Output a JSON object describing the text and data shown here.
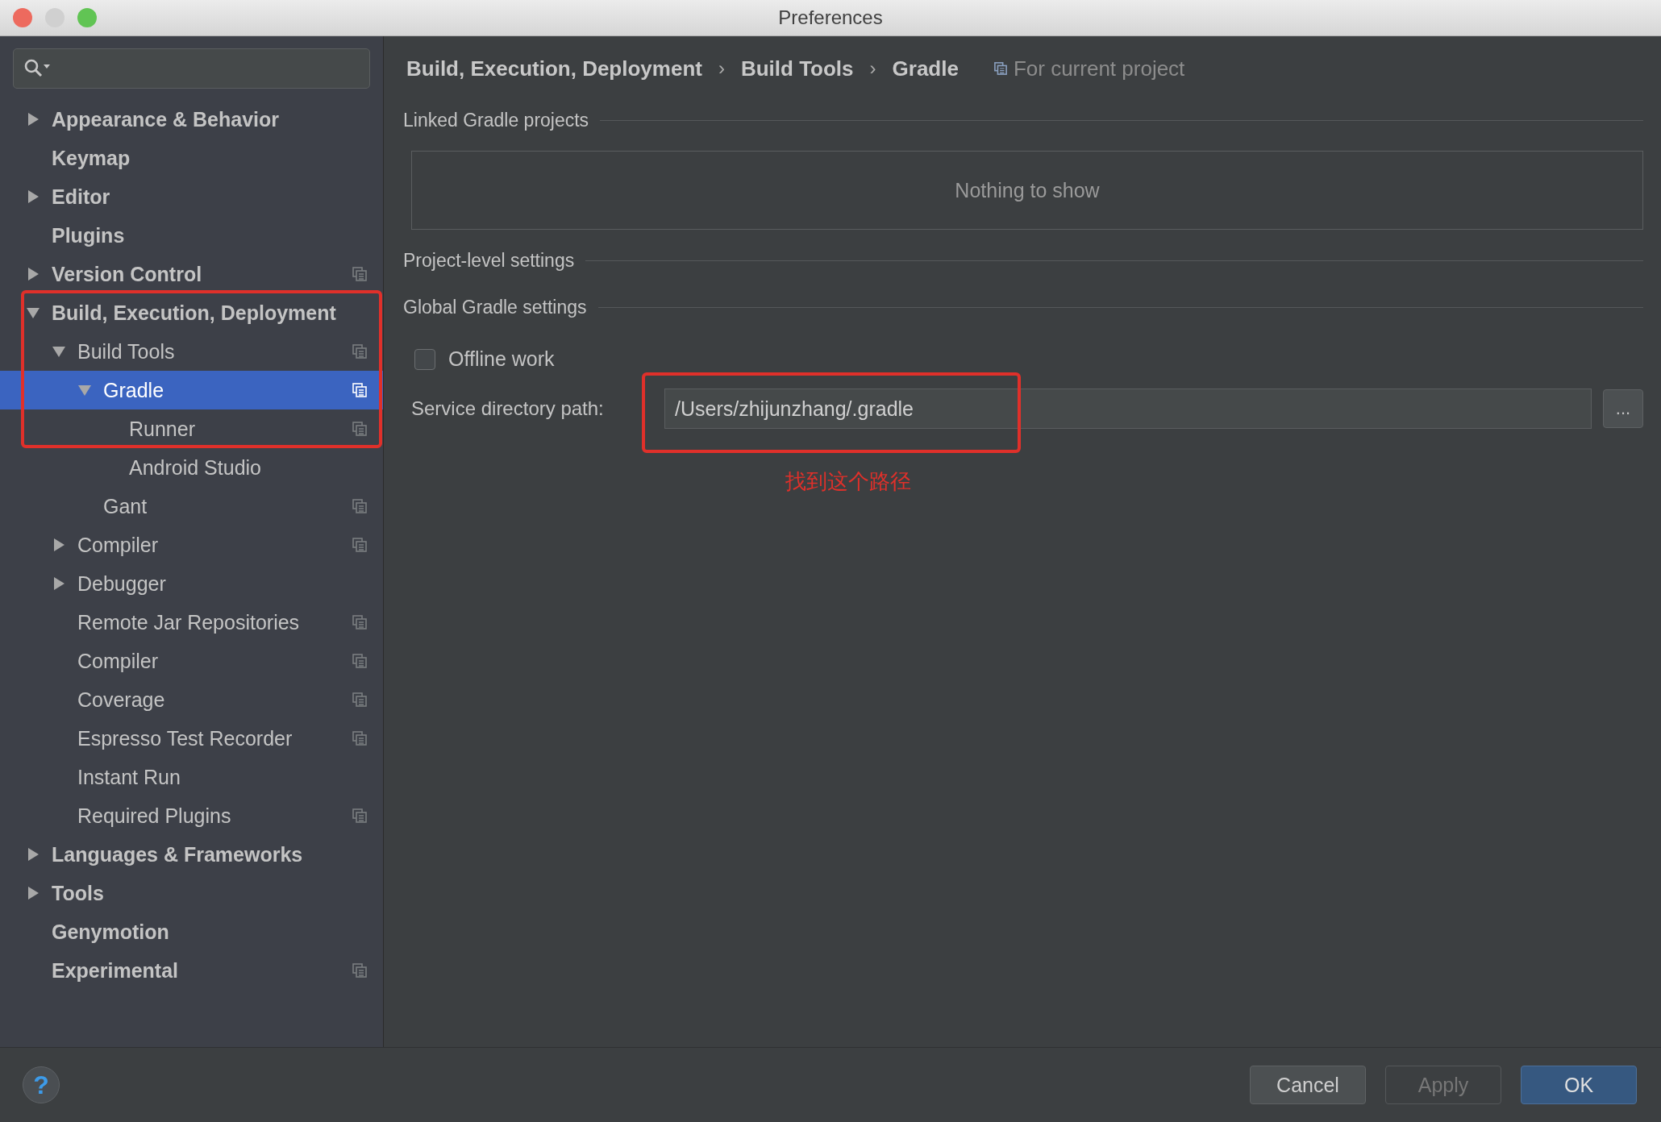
{
  "window": {
    "title": "Preferences"
  },
  "sidebar": {
    "items": [
      {
        "label": "Appearance & Behavior",
        "expanded": false,
        "selected": false,
        "project_level": false
      },
      {
        "label": "Keymap",
        "selected": false,
        "project_level": false
      },
      {
        "label": "Editor",
        "expanded": false,
        "selected": false,
        "project_level": false
      },
      {
        "label": "Plugins",
        "selected": false,
        "project_level": false
      },
      {
        "label": "Version Control",
        "expanded": false,
        "selected": false,
        "project_level": true
      },
      {
        "label": "Build, Execution, Deployment",
        "expanded": true,
        "selected": false,
        "project_level": false,
        "children": [
          {
            "label": "Build Tools",
            "expanded": true,
            "selected": false,
            "project_level": true,
            "children": [
              {
                "label": "Gradle",
                "expanded": true,
                "selected": true,
                "project_level": true,
                "children": [
                  {
                    "label": "Runner",
                    "selected": false,
                    "project_level": true
                  },
                  {
                    "label": "Android Studio",
                    "selected": false,
                    "project_level": false
                  }
                ]
              },
              {
                "label": "Gant",
                "selected": false,
                "project_level": true
              }
            ]
          },
          {
            "label": "Compiler",
            "expanded": false,
            "selected": false,
            "project_level": true
          },
          {
            "label": "Debugger",
            "expanded": false,
            "selected": false,
            "project_level": false
          },
          {
            "label": "Remote Jar Repositories",
            "selected": false,
            "project_level": true
          },
          {
            "label": "Compiler",
            "selected": false,
            "project_level": true
          },
          {
            "label": "Coverage",
            "selected": false,
            "project_level": true
          },
          {
            "label": "Espresso Test Recorder",
            "selected": false,
            "project_level": true
          },
          {
            "label": "Instant Run",
            "selected": false,
            "project_level": false
          },
          {
            "label": "Required Plugins",
            "selected": false,
            "project_level": true
          }
        ]
      },
      {
        "label": "Languages & Frameworks",
        "expanded": false,
        "selected": false,
        "project_level": false
      },
      {
        "label": "Tools",
        "expanded": false,
        "selected": false,
        "project_level": false
      },
      {
        "label": "Genymotion",
        "selected": false,
        "project_level": false
      },
      {
        "label": "Experimental",
        "selected": false,
        "project_level": true
      }
    ]
  },
  "breadcrumb": {
    "items": [
      "Build, Execution, Deployment",
      "Build Tools",
      "Gradle"
    ],
    "separator": "›",
    "scope": "For current project"
  },
  "linked_projects": {
    "title": "Linked Gradle projects",
    "empty_text": "Nothing to show"
  },
  "project_settings": {
    "title": "Project-level settings"
  },
  "global_settings": {
    "title": "Global Gradle settings",
    "offline": {
      "label": "Offline work",
      "checked": false
    },
    "service_path": {
      "label": "Service directory path:",
      "value": "/Users/zhijunzhang/.gradle",
      "browse": "..."
    }
  },
  "annotation": {
    "note": "找到这个路径"
  },
  "footer": {
    "help": "?",
    "buttons": [
      {
        "label": "Cancel",
        "disabled": false,
        "primary": false
      },
      {
        "label": "Apply",
        "disabled": true,
        "primary": false
      },
      {
        "label": "OK",
        "disabled": false,
        "primary": true
      }
    ]
  }
}
